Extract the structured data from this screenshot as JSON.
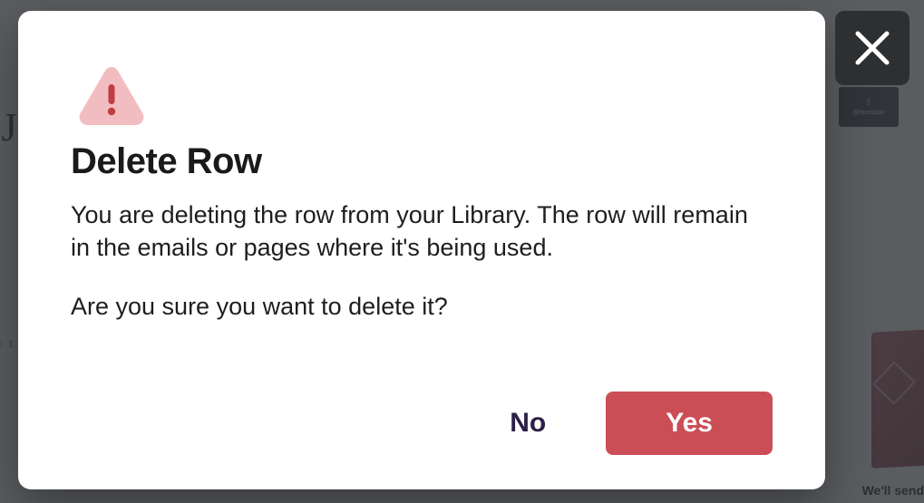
{
  "background": {
    "brand_letter": "J",
    "brand_sub": "I E",
    "social_block": {
      "icon_glyph": "f",
      "label": "@facebook"
    },
    "footer_snippet": "We'll send"
  },
  "modal": {
    "icon": "warning-triangle",
    "title": "Delete Row",
    "body": "You are deleting the row from your Library. The row will remain in the emails or pages where it's being used.",
    "confirm": "Are you sure you want to delete it?",
    "no_label": "No",
    "yes_label": "Yes"
  },
  "close_button": {
    "icon": "close-x"
  },
  "colors": {
    "danger": "#cb4e56",
    "danger_icon_bg": "#f2bdc0",
    "danger_icon_fg": "#c13d45",
    "overlay": "rgba(45,48,52,0.78)",
    "close_bg": "#2e2f31"
  }
}
